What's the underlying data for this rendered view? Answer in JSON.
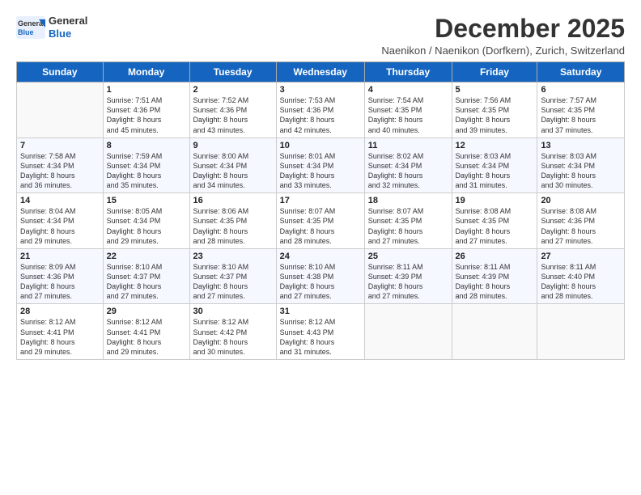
{
  "header": {
    "logo_line1": "General",
    "logo_line2": "Blue",
    "title": "December 2025",
    "subtitle": "Naenikon / Naenikon (Dorfkern), Zurich, Switzerland"
  },
  "days_of_week": [
    "Sunday",
    "Monday",
    "Tuesday",
    "Wednesday",
    "Thursday",
    "Friday",
    "Saturday"
  ],
  "weeks": [
    [
      {
        "day": "",
        "text": ""
      },
      {
        "day": "1",
        "text": "Sunrise: 7:51 AM\nSunset: 4:36 PM\nDaylight: 8 hours\nand 45 minutes."
      },
      {
        "day": "2",
        "text": "Sunrise: 7:52 AM\nSunset: 4:36 PM\nDaylight: 8 hours\nand 43 minutes."
      },
      {
        "day": "3",
        "text": "Sunrise: 7:53 AM\nSunset: 4:36 PM\nDaylight: 8 hours\nand 42 minutes."
      },
      {
        "day": "4",
        "text": "Sunrise: 7:54 AM\nSunset: 4:35 PM\nDaylight: 8 hours\nand 40 minutes."
      },
      {
        "day": "5",
        "text": "Sunrise: 7:56 AM\nSunset: 4:35 PM\nDaylight: 8 hours\nand 39 minutes."
      },
      {
        "day": "6",
        "text": "Sunrise: 7:57 AM\nSunset: 4:35 PM\nDaylight: 8 hours\nand 37 minutes."
      }
    ],
    [
      {
        "day": "7",
        "text": "Sunrise: 7:58 AM\nSunset: 4:34 PM\nDaylight: 8 hours\nand 36 minutes."
      },
      {
        "day": "8",
        "text": "Sunrise: 7:59 AM\nSunset: 4:34 PM\nDaylight: 8 hours\nand 35 minutes."
      },
      {
        "day": "9",
        "text": "Sunrise: 8:00 AM\nSunset: 4:34 PM\nDaylight: 8 hours\nand 34 minutes."
      },
      {
        "day": "10",
        "text": "Sunrise: 8:01 AM\nSunset: 4:34 PM\nDaylight: 8 hours\nand 33 minutes."
      },
      {
        "day": "11",
        "text": "Sunrise: 8:02 AM\nSunset: 4:34 PM\nDaylight: 8 hours\nand 32 minutes."
      },
      {
        "day": "12",
        "text": "Sunrise: 8:03 AM\nSunset: 4:34 PM\nDaylight: 8 hours\nand 31 minutes."
      },
      {
        "day": "13",
        "text": "Sunrise: 8:03 AM\nSunset: 4:34 PM\nDaylight: 8 hours\nand 30 minutes."
      }
    ],
    [
      {
        "day": "14",
        "text": "Sunrise: 8:04 AM\nSunset: 4:34 PM\nDaylight: 8 hours\nand 29 minutes."
      },
      {
        "day": "15",
        "text": "Sunrise: 8:05 AM\nSunset: 4:34 PM\nDaylight: 8 hours\nand 29 minutes."
      },
      {
        "day": "16",
        "text": "Sunrise: 8:06 AM\nSunset: 4:35 PM\nDaylight: 8 hours\nand 28 minutes."
      },
      {
        "day": "17",
        "text": "Sunrise: 8:07 AM\nSunset: 4:35 PM\nDaylight: 8 hours\nand 28 minutes."
      },
      {
        "day": "18",
        "text": "Sunrise: 8:07 AM\nSunset: 4:35 PM\nDaylight: 8 hours\nand 27 minutes."
      },
      {
        "day": "19",
        "text": "Sunrise: 8:08 AM\nSunset: 4:35 PM\nDaylight: 8 hours\nand 27 minutes."
      },
      {
        "day": "20",
        "text": "Sunrise: 8:08 AM\nSunset: 4:36 PM\nDaylight: 8 hours\nand 27 minutes."
      }
    ],
    [
      {
        "day": "21",
        "text": "Sunrise: 8:09 AM\nSunset: 4:36 PM\nDaylight: 8 hours\nand 27 minutes."
      },
      {
        "day": "22",
        "text": "Sunrise: 8:10 AM\nSunset: 4:37 PM\nDaylight: 8 hours\nand 27 minutes."
      },
      {
        "day": "23",
        "text": "Sunrise: 8:10 AM\nSunset: 4:37 PM\nDaylight: 8 hours\nand 27 minutes."
      },
      {
        "day": "24",
        "text": "Sunrise: 8:10 AM\nSunset: 4:38 PM\nDaylight: 8 hours\nand 27 minutes."
      },
      {
        "day": "25",
        "text": "Sunrise: 8:11 AM\nSunset: 4:39 PM\nDaylight: 8 hours\nand 27 minutes."
      },
      {
        "day": "26",
        "text": "Sunrise: 8:11 AM\nSunset: 4:39 PM\nDaylight: 8 hours\nand 28 minutes."
      },
      {
        "day": "27",
        "text": "Sunrise: 8:11 AM\nSunset: 4:40 PM\nDaylight: 8 hours\nand 28 minutes."
      }
    ],
    [
      {
        "day": "28",
        "text": "Sunrise: 8:12 AM\nSunset: 4:41 PM\nDaylight: 8 hours\nand 29 minutes."
      },
      {
        "day": "29",
        "text": "Sunrise: 8:12 AM\nSunset: 4:41 PM\nDaylight: 8 hours\nand 29 minutes."
      },
      {
        "day": "30",
        "text": "Sunrise: 8:12 AM\nSunset: 4:42 PM\nDaylight: 8 hours\nand 30 minutes."
      },
      {
        "day": "31",
        "text": "Sunrise: 8:12 AM\nSunset: 4:43 PM\nDaylight: 8 hours\nand 31 minutes."
      },
      {
        "day": "",
        "text": ""
      },
      {
        "day": "",
        "text": ""
      },
      {
        "day": "",
        "text": ""
      }
    ]
  ]
}
